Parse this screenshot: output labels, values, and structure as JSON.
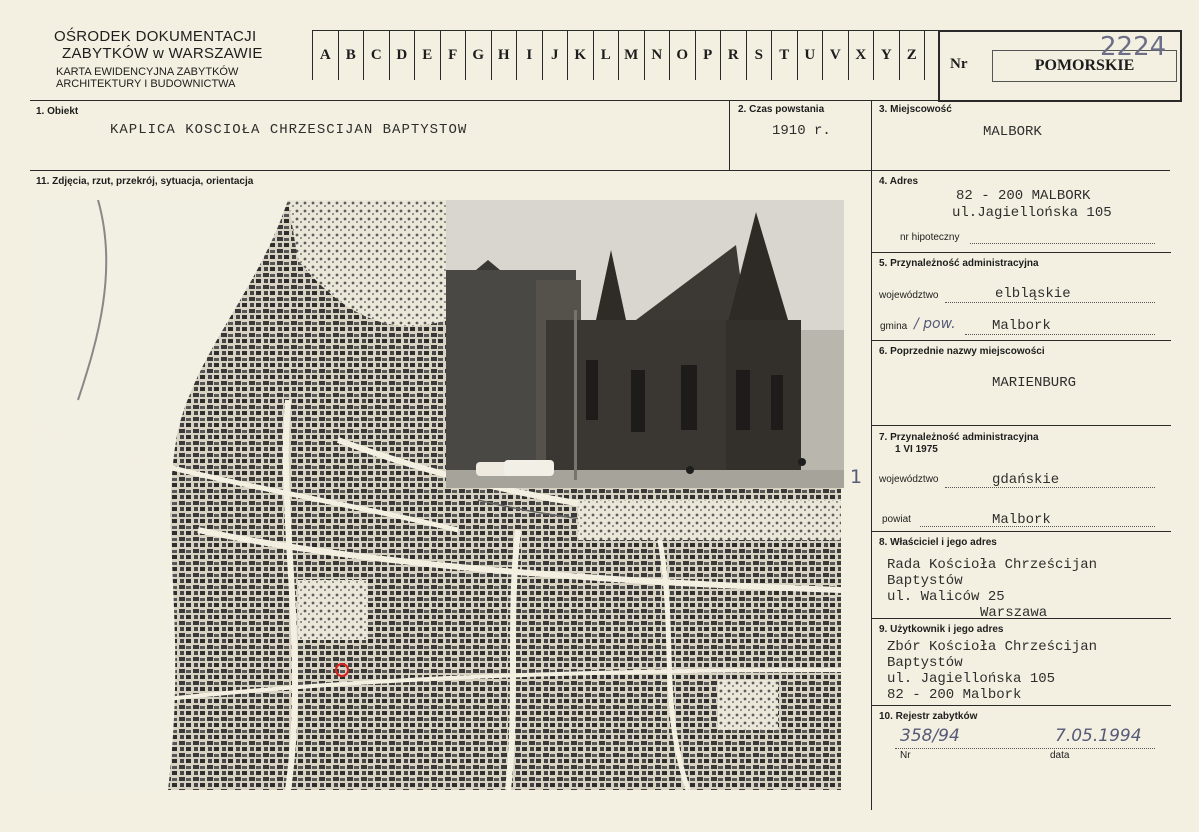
{
  "header": {
    "institution_line1": "OŚRODEK DOKUMENTACJI",
    "institution_line2": "ZABYTKÓW w WARSZAWIE",
    "card_line1": "KARTA EWIDENCYJNA ZABYTKÓW",
    "card_line2": "ARCHITEKTURY I BUDOWNICTWA",
    "letters": [
      "A",
      "B",
      "C",
      "D",
      "E",
      "F",
      "G",
      "H",
      "I",
      "J",
      "K",
      "L",
      "M",
      "N",
      "O",
      "P",
      "R",
      "S",
      "T",
      "U",
      "V",
      "X",
      "Y",
      "Z"
    ],
    "nr_label": "Nr",
    "region": "POMORSKIE",
    "card_number": "2224"
  },
  "fields": {
    "obiekt": {
      "label": "1. Obiekt",
      "value": "KAPLICA KOSCIOŁA CHRZESCIJAN BAPTYSTOW"
    },
    "czas": {
      "label": "2. Czas powstania",
      "value": "1910 r."
    },
    "miejscowosc": {
      "label": "3. Miejscowość",
      "value": "MALBORK"
    },
    "zdjecia": {
      "label": "11. Zdjęcia, rzut, przekrój, sytuacja, orientacja",
      "photo_number": "1"
    },
    "adres": {
      "label": "4. Adres",
      "line1": "82 - 200 MALBORK",
      "line2": "ul.Jagiellońska 105",
      "hipoteczny_label": "nr hipoteczny"
    },
    "przynaleznosc": {
      "label": "5. Przynależność administracyjna",
      "wojewodztwo_label": "województwo",
      "wojewodztwo": "elbląskie",
      "gmina_label": "gmina",
      "gmina_hand": "/ pow.",
      "gmina": "Malbork"
    },
    "poprzednie": {
      "label": "6. Poprzednie nazwy miejscowości",
      "value": "MARIENBURG"
    },
    "przynaleznosc1975": {
      "label": "7. Przynależność administracyjna",
      "date": "1 VI 1975",
      "wojewodztwo_label": "województwo",
      "wojewodztwo": "gdańskie",
      "powiat_label": "powiat",
      "powiat": "Malbork"
    },
    "wlasciciel": {
      "label": "8. Właściciel i jego adres",
      "line1": "Rada Kościoła Chrześcijan",
      "line2": "Baptystów",
      "line3": "ul. Waliców 25",
      "line4": "Warszawa"
    },
    "uzytkownik": {
      "label": "9. Użytkownik i jego adres",
      "line1": "Zbór Kościoła Chrześcijan",
      "line2": "Baptystów",
      "line3": "ul. Jagiellońska 105",
      "line4": "82 - 200  Malbork"
    },
    "rejestr": {
      "label": "10. Rejestr zabytków",
      "nr_value": "358/94",
      "data_value": "7.05.1994",
      "nr_label": "Nr",
      "data_label": "data"
    }
  }
}
